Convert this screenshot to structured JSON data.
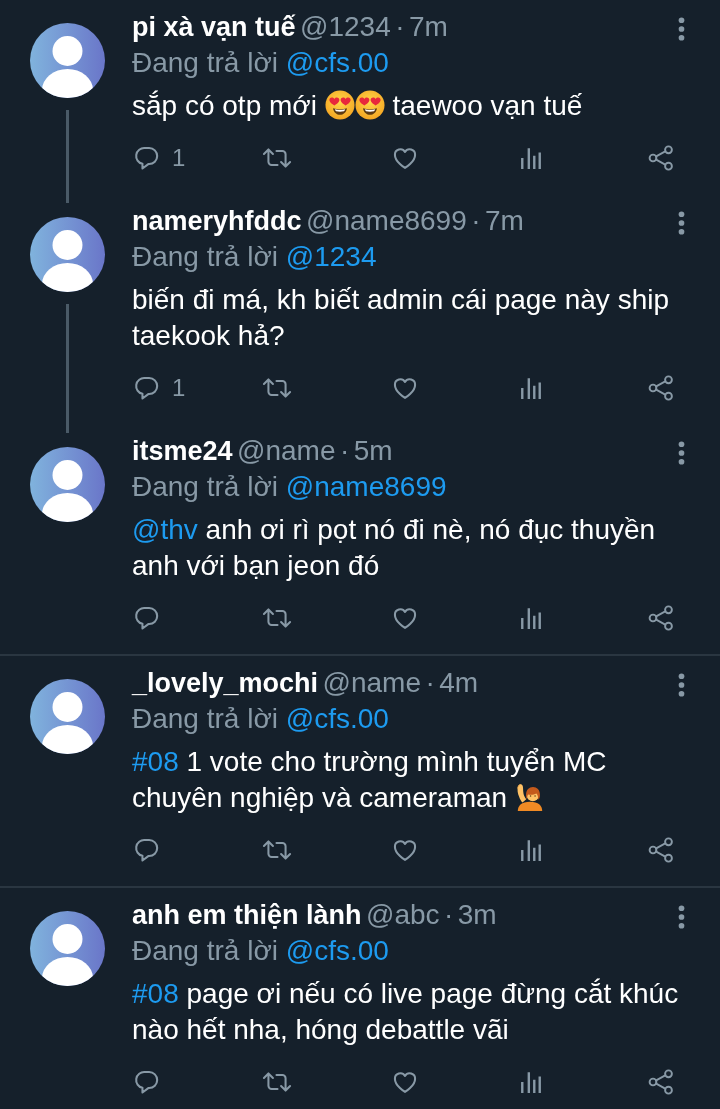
{
  "tweets": [
    {
      "name": "pi xà vạn tuế",
      "handle": "@1234",
      "separator": "·",
      "time": "7m",
      "replying_label": "Đang trả lời",
      "replying_to": "@cfs.00",
      "body": [
        {
          "kind": "text",
          "text": "sắp có otp mới "
        },
        {
          "kind": "heart_eyes"
        },
        {
          "kind": "heart_eyes"
        },
        {
          "kind": "text",
          "text": " taewoo vạn tuế"
        }
      ],
      "reply_count": "1",
      "thread_to_next": true
    },
    {
      "name": "nameryhfddc",
      "handle": "@name8699",
      "separator": "·",
      "time": "7m",
      "replying_label": "Đang trả lời",
      "replying_to": "@1234",
      "body": [
        {
          "kind": "text",
          "text": "biến đi má, kh biết admin cái page này ship taekook hả?"
        }
      ],
      "reply_count": "1",
      "thread_to_next": true
    },
    {
      "name": "itsme24",
      "handle": "@name",
      "separator": "·",
      "time": "5m",
      "replying_label": "Đang trả lời",
      "replying_to": "@name8699",
      "body": [
        {
          "kind": "mention",
          "text": "@thv"
        },
        {
          "kind": "text",
          "text": " anh ơi rì pọt nó đi nè, nó đục thuyền anh với bạn jeon đó"
        }
      ],
      "thread_to_next": false
    },
    {
      "name": "_lovely_mochi",
      "handle": "@name",
      "separator": "·",
      "time": "4m",
      "replying_label": "Đang trả lời",
      "replying_to": "@cfs.00",
      "body": [
        {
          "kind": "hashtag",
          "text": "#08"
        },
        {
          "kind": "text",
          "text": " 1 vote cho trường mình tuyển MC chuyên nghiệp và cameraman "
        },
        {
          "kind": "raising_hand"
        }
      ],
      "thread_to_next": false
    },
    {
      "name": "anh em thiện lành",
      "handle": "@abc",
      "separator": "·",
      "time": "3m",
      "replying_label": "Đang trả lời",
      "replying_to": "@cfs.00",
      "body": [
        {
          "kind": "hashtag",
          "text": "#08"
        },
        {
          "kind": "text",
          "text": " page ơi nếu có live page đừng cắt khúc nào hết nha, hóng debattle vãi"
        }
      ]
    }
  ]
}
